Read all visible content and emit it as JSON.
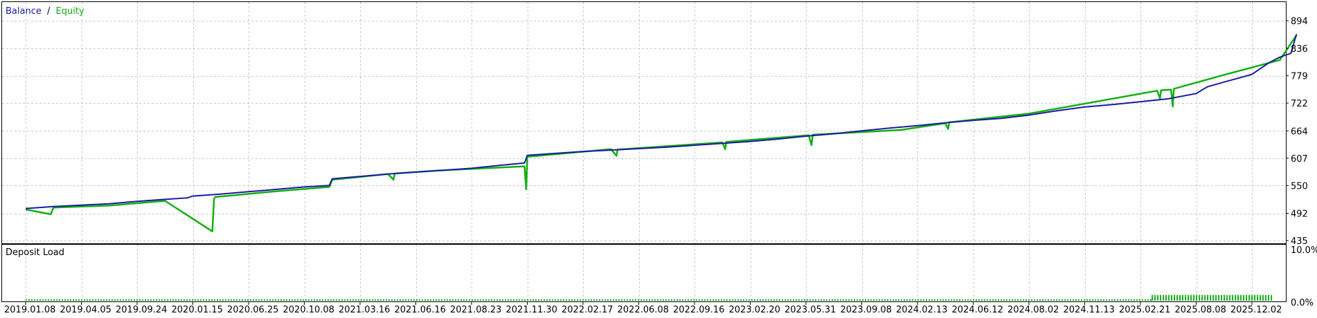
{
  "legend": {
    "balance_label": "Balance",
    "separator": "/",
    "equity_label": "Equity"
  },
  "deposit_load": {
    "label": "Deposit Load",
    "ticks": [
      "10.0%",
      "0.0%"
    ]
  },
  "colors": {
    "balance": "#1a1aa6",
    "equity": "#11b011",
    "grid": "#c8c8c8",
    "frame": "#000000",
    "load": "#11b011"
  },
  "chart_data": [
    {
      "type": "line",
      "title": "",
      "x_ticks": [
        "2019.01.08",
        "2019.04.05",
        "2019.09.24",
        "2020.01.15",
        "2020.06.25",
        "2020.10.08",
        "2021.03.16",
        "2021.06.16",
        "2021.08.23",
        "2021.11.30",
        "2022.02.17",
        "2022.06.08",
        "2022.09.16",
        "2023.02.20",
        "2023.05.31",
        "2023.09.08",
        "2024.02.13",
        "2024.06.12",
        "2024.08.02",
        "2024.11.13",
        "2025.02.21",
        "2025.08.08",
        "2025.12.02"
      ],
      "y_ticks": [
        894,
        836,
        779,
        722,
        664,
        607,
        550,
        492,
        435
      ],
      "ylim": [
        435,
        915
      ],
      "series": [
        {
          "name": "Balance",
          "x": [
            0,
            0.5,
            1,
            1.5,
            2,
            2.5,
            2.9,
            3,
            3.5,
            4,
            4.5,
            5,
            5.45,
            5.5,
            6,
            6.5,
            7,
            7.5,
            8,
            8.5,
            8.95,
            9,
            9.5,
            10,
            10.5,
            11,
            11.5,
            12,
            12.5,
            13,
            13.5,
            14,
            14.5,
            15,
            15.5,
            16,
            16.5,
            17,
            17.5,
            18,
            18.5,
            19,
            19.5,
            20,
            20.5,
            21,
            21.2,
            21.5,
            22,
            22.3,
            22.5,
            22.7,
            22.8
          ],
          "y": [
            502,
            506,
            509,
            512,
            517,
            521,
            524,
            528,
            532,
            537,
            542,
            547,
            550,
            564,
            569,
            574,
            578,
            582,
            586,
            592,
            597,
            613,
            617,
            621,
            624,
            627,
            630,
            634,
            638,
            642,
            647,
            653,
            658,
            664,
            670,
            675,
            681,
            686,
            690,
            697,
            706,
            714,
            719,
            725,
            731,
            742,
            756,
            766,
            782,
            806,
            818,
            826,
            866
          ]
        },
        {
          "name": "Equity",
          "x": [
            0,
            0.45,
            0.5,
            1.5,
            2.5,
            3.35,
            3.38,
            3.4,
            4.5,
            5.45,
            5.5,
            6.5,
            6.6,
            6.62,
            7.5,
            8.95,
            8.98,
            9,
            10.5,
            10.6,
            10.62,
            12.5,
            12.55,
            12.57,
            14.05,
            14.1,
            14.12,
            15.7,
            16.5,
            16.55,
            16.57,
            18,
            20.3,
            20.35,
            20.37,
            20.55,
            20.58,
            20.6,
            21.5,
            22.5,
            22.8
          ],
          "y": [
            500,
            490,
            504,
            508,
            518,
            454,
            522,
            526,
            538,
            547,
            562,
            574,
            562,
            575,
            582,
            590,
            542,
            610,
            626,
            612,
            625,
            640,
            626,
            641,
            655,
            634,
            656,
            666,
            680,
            668,
            682,
            700,
            748,
            732,
            749,
            750,
            715,
            752,
            781,
            812,
            864
          ]
        }
      ]
    },
    {
      "type": "bar",
      "title": "Deposit Load",
      "ylim": [
        0,
        10
      ],
      "y_ticks": [
        "10.0%",
        "0.0%"
      ],
      "segments": [
        {
          "x_start": 0,
          "x_end": 20.2,
          "value": 0.3
        },
        {
          "x_start": 20.2,
          "x_end": 22.8,
          "value": 1.2
        }
      ]
    }
  ]
}
